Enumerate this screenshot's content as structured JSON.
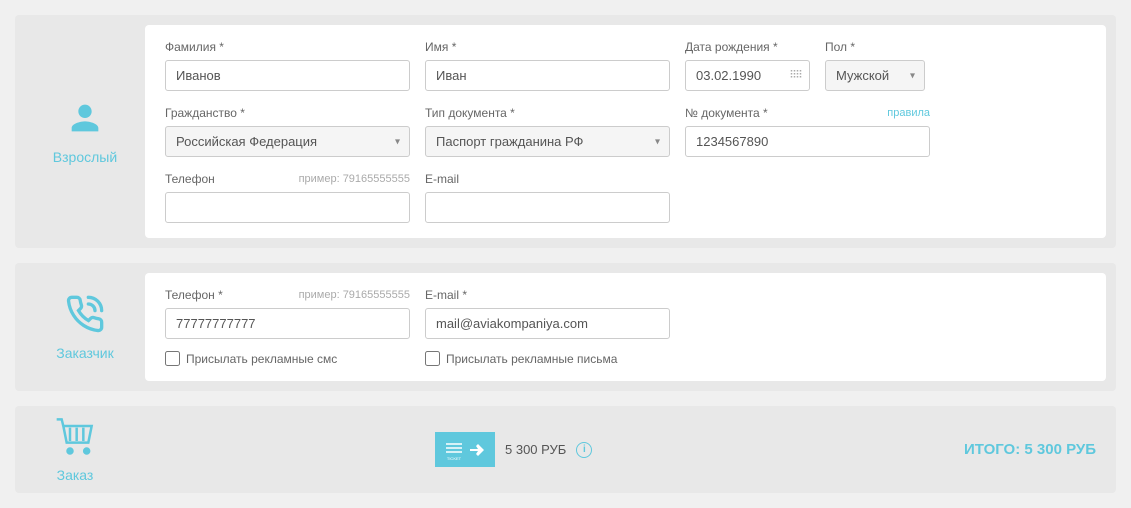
{
  "passenger": {
    "sidebar_label": "Взрослый",
    "surname_label": "Фамилия *",
    "surname_value": "Иванов",
    "name_label": "Имя *",
    "name_value": "Иван",
    "birthdate_label": "Дата рождения *",
    "birthdate_value": "03.02.1990",
    "gender_label": "Пол *",
    "gender_value": "Мужской",
    "citizenship_label": "Гражданство *",
    "citizenship_value": "Российская Федерация",
    "doctype_label": "Тип документа *",
    "doctype_value": "Паспорт гражданина РФ",
    "docnum_label": "№ документа *",
    "docnum_value": "1234567890",
    "rules_link": "правила",
    "phone_label": "Телефон",
    "phone_hint": "пример: 79165555555",
    "phone_value": "",
    "email_label": "E-mail",
    "email_value": ""
  },
  "customer": {
    "sidebar_label": "Заказчик",
    "phone_label": "Телефон *",
    "phone_hint": "пример: 79165555555",
    "phone_value": "77777777777",
    "email_label": "E-mail *",
    "email_value": "mail@aviakompaniya.com",
    "sms_checkbox": "Присылать рекламные смс",
    "email_checkbox": "Присылать рекламные письма"
  },
  "order": {
    "sidebar_label": "Заказ",
    "ticket_price": "5 300 РУБ",
    "total_label": "ИТОГО: 5 300 РУБ"
  }
}
